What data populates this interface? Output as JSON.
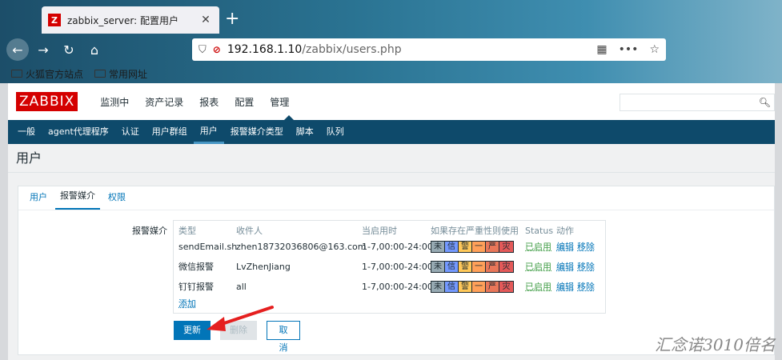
{
  "browser": {
    "tab_favicon": "Z",
    "tab_title": "zabbix_server: 配置用户",
    "tab_close": "✕",
    "new_tab": "+",
    "url_host": "192.168.1.10",
    "url_path": "/zabbix/users.php",
    "bookmarks": [
      "火狐官方站点",
      "常用网址"
    ]
  },
  "header": {
    "logo": "ZABBIX",
    "menu": [
      "监测中",
      "资产记录",
      "报表",
      "配置",
      "管理"
    ],
    "active_menu": "管理"
  },
  "subnav": {
    "items": [
      "一般",
      "agent代理程序",
      "认证",
      "用户群组",
      "用户",
      "报警媒介类型",
      "脚本",
      "队列"
    ],
    "active": "用户"
  },
  "page_title": "用户",
  "form_tabs": {
    "items": [
      "用户",
      "报警媒介",
      "权限"
    ],
    "active": "报警媒介"
  },
  "media": {
    "label": "报警媒介",
    "columns": [
      "类型",
      "收件人",
      "当启用时",
      "如果存在严重性则使用",
      "Status",
      "动作"
    ],
    "severity_letters": [
      "未",
      "信",
      "警",
      "一",
      "严",
      "灾"
    ],
    "severity_colors": [
      "#97aab3",
      "#7499ff",
      "#ffc859",
      "#ffa059",
      "#e97659",
      "#e45959"
    ],
    "rows": [
      {
        "type": "sendEmail.sh",
        "recipient": "zhen18732036806@163.com",
        "when": "1-7,00:00-24:00",
        "status": "已启用",
        "edit": "编辑",
        "remove": "移除"
      },
      {
        "type": "微信报警",
        "recipient": "LvZhenJiang",
        "when": "1-7,00:00-24:00",
        "status": "已启用",
        "edit": "编辑",
        "remove": "移除"
      },
      {
        "type": "钉钉报警",
        "recipient": "all",
        "when": "1-7,00:00-24:00",
        "status": "已启用",
        "edit": "编辑",
        "remove": "移除"
      }
    ],
    "add": "添加"
  },
  "buttons": {
    "update": "更新",
    "delete": "删除",
    "cancel": "取消"
  },
  "watermark": "汇念诺3010倍名"
}
